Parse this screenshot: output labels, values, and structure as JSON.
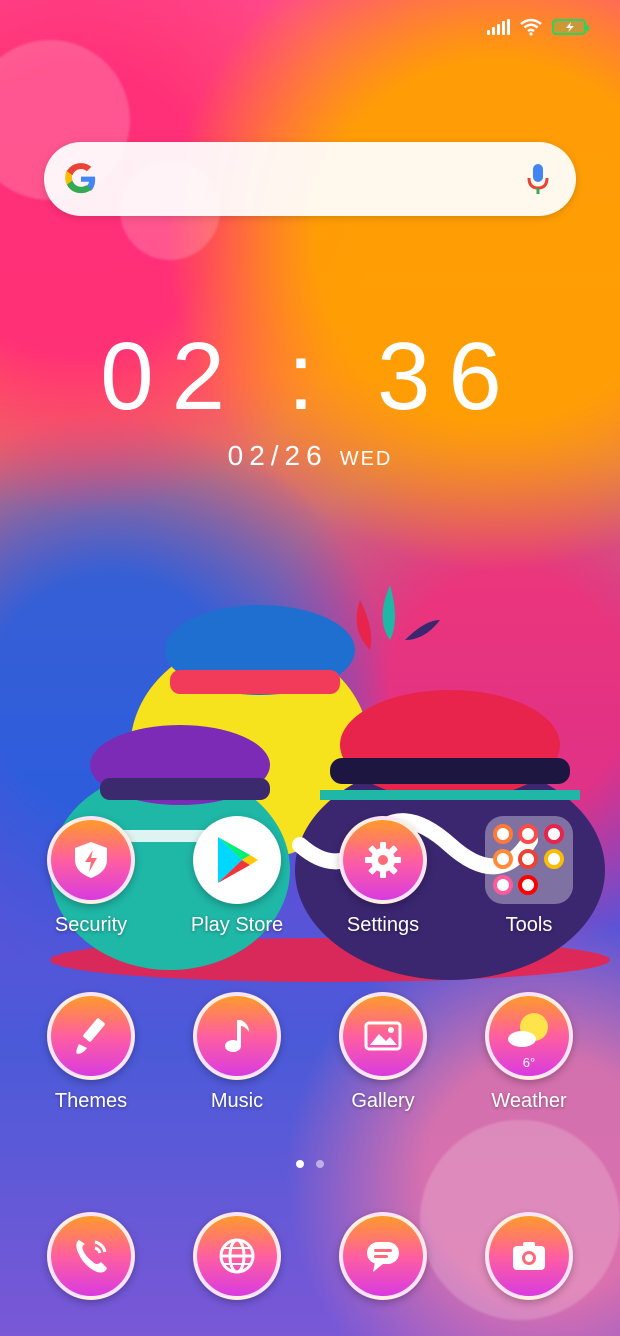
{
  "status_bar": {
    "icons": [
      "signal-icon",
      "wifi-icon",
      "battery-charging-icon"
    ],
    "battery_color": "#2bd45d"
  },
  "search_bar": {
    "icons": [
      "google-logo",
      "microphone-icon"
    ]
  },
  "clock": {
    "time": "02 : 36",
    "date": "02/26",
    "weekday": "WED"
  },
  "home_row1": [
    {
      "label": "Security",
      "icon": "shield-lightning-icon"
    },
    {
      "label": "Play Store",
      "icon": "play-store-icon"
    },
    {
      "label": "Settings",
      "icon": "gear-icon"
    },
    {
      "label": "Tools",
      "icon": "folder-icon"
    }
  ],
  "home_row2": [
    {
      "label": "Themes",
      "icon": "paintbrush-icon"
    },
    {
      "label": "Music",
      "icon": "music-note-icon"
    },
    {
      "label": "Gallery",
      "icon": "image-icon"
    },
    {
      "label": "Weather",
      "icon": "sun-cloud-icon",
      "temp": "6°"
    }
  ],
  "page_indicator": {
    "pages": 2,
    "active": 1
  },
  "dock": [
    {
      "icon": "phone-icon"
    },
    {
      "icon": "globe-icon"
    },
    {
      "icon": "message-icon"
    },
    {
      "icon": "camera-icon"
    }
  ],
  "colors": {
    "icon_gradient_top": "#ff9a2a",
    "icon_gradient_mid": "#ff5fa0",
    "icon_gradient_bottom": "#d93be0"
  }
}
